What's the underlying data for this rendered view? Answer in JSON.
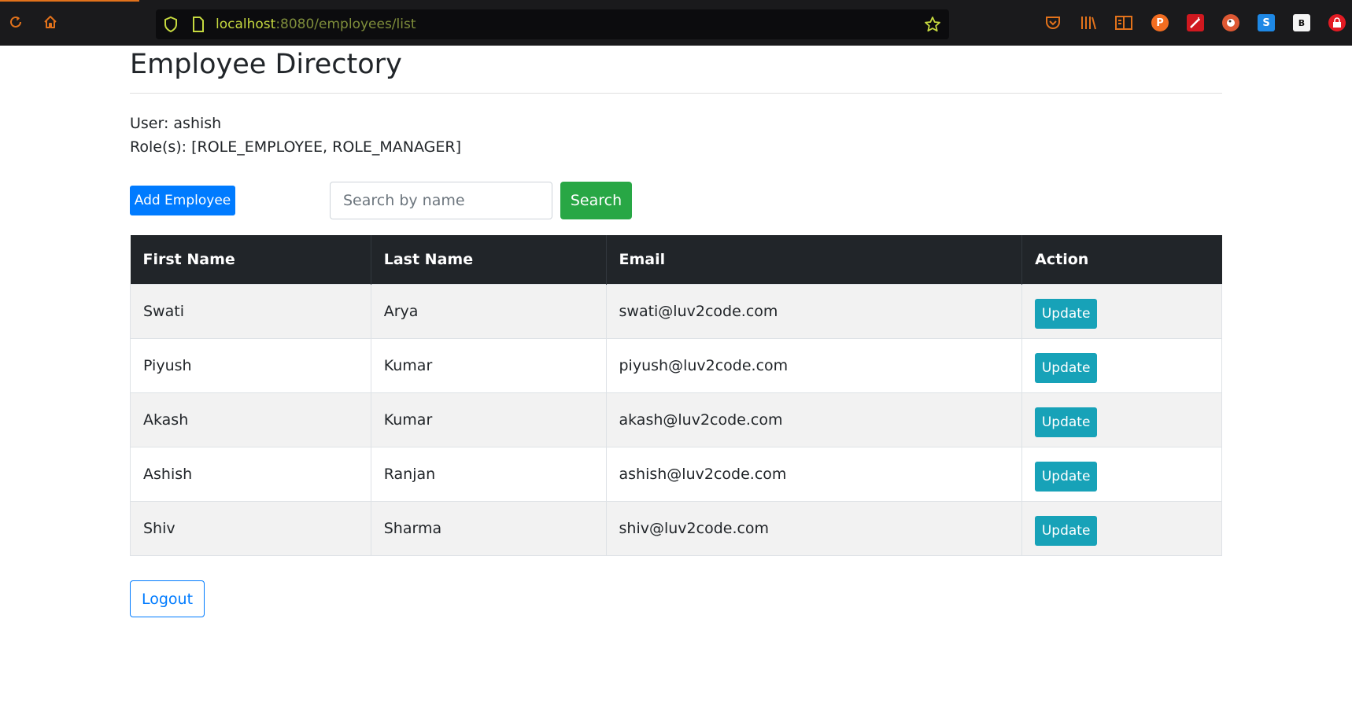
{
  "browser": {
    "url_host": "localhost",
    "url_path": ":8080/employees/list",
    "extensions": [
      {
        "name": "pocket-icon",
        "letter": ""
      },
      {
        "name": "library-icon",
        "letter": ""
      },
      {
        "name": "reader-view-icon",
        "letter": ""
      },
      {
        "name": "extension-p-icon",
        "letter": "P"
      },
      {
        "name": "extension-wand-icon",
        "letter": ""
      },
      {
        "name": "duckduckgo-icon",
        "letter": ""
      },
      {
        "name": "extension-s-icon",
        "letter": "S"
      },
      {
        "name": "extension-b-icon",
        "letter": "B"
      },
      {
        "name": "extension-lock-icon",
        "letter": ""
      }
    ]
  },
  "page": {
    "title": "Employee Directory",
    "user_line": "User: ashish",
    "roles_line": "Role(s): [ROLE_EMPLOYEE, ROLE_MANAGER]"
  },
  "actions": {
    "add_employee": "Add Employee",
    "search_placeholder": "Search by name",
    "search_button": "Search",
    "logout": "Logout"
  },
  "table": {
    "headers": [
      "First Name",
      "Last Name",
      "Email",
      "Action"
    ],
    "update_label": "Update",
    "rows": [
      {
        "first": "Swati",
        "last": "Arya",
        "email": "swati@luv2code.com"
      },
      {
        "first": "Piyush",
        "last": "Kumar",
        "email": "piyush@luv2code.com"
      },
      {
        "first": "Akash",
        "last": "Kumar",
        "email": "akash@luv2code.com"
      },
      {
        "first": "Ashish",
        "last": "Ranjan",
        "email": "ashish@luv2code.com"
      },
      {
        "first": "Shiv",
        "last": "Sharma",
        "email": "shiv@luv2code.com"
      }
    ]
  },
  "colors": {
    "primary": "#007bff",
    "success": "#28a745",
    "info": "#17a2b8",
    "table_header": "#212529",
    "browser_accent": "#e2721b"
  }
}
